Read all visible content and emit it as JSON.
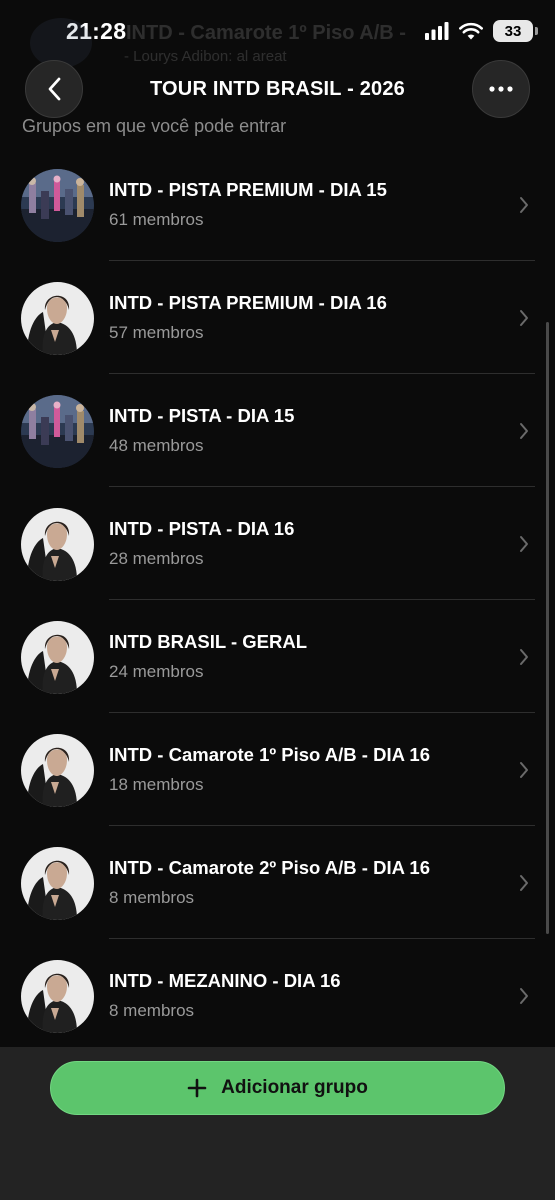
{
  "status_bar": {
    "time": "21:28",
    "battery": "33"
  },
  "background_header": {
    "title": "INTD - Camarote 1º Piso A/B -",
    "subtitle": "- Lourys Adibon: al areat"
  },
  "header": {
    "title": "TOUR INTD BRASIL - 2026"
  },
  "section": {
    "label": "Grupos em que você pode entrar"
  },
  "groups": [
    {
      "name": "INTD - PISTA PREMIUM - DIA 15",
      "members": "61 membros",
      "avatar": "concert-stage"
    },
    {
      "name": "INTD - PISTA PREMIUM - DIA 16",
      "members": "57 membros",
      "avatar": "artist-portrait"
    },
    {
      "name": "INTD - PISTA - DIA 15",
      "members": "48 membros",
      "avatar": "concert-stage"
    },
    {
      "name": "INTD - PISTA - DIA 16",
      "members": "28 membros",
      "avatar": "artist-portrait"
    },
    {
      "name": "INTD BRASIL - GERAL",
      "members": "24 membros",
      "avatar": "artist-portrait"
    },
    {
      "name": "INTD - Camarote 1º Piso A/B - DIA 16",
      "members": "18 membros",
      "avatar": "artist-portrait"
    },
    {
      "name": "INTD - Camarote 2º Piso A/B - DIA 16",
      "members": "8 membros",
      "avatar": "artist-portrait"
    },
    {
      "name": "INTD - MEZANINO - DIA 16",
      "members": "8 membros",
      "avatar": "artist-portrait"
    }
  ],
  "footer": {
    "add_button_label": "Adicionar grupo"
  },
  "colors": {
    "background": "#0b0b0b",
    "accent_green": "#5cc56c",
    "secondary_text": "#9a9a9a"
  }
}
